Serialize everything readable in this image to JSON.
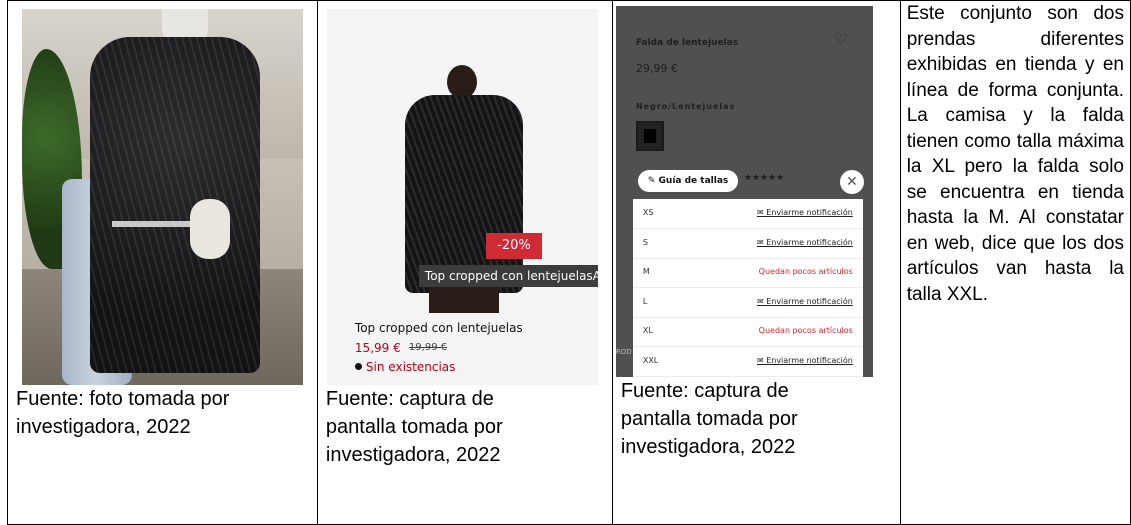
{
  "cells": [
    {
      "caption": "Fuente: foto tomada por investigadora, 2022",
      "caption_lines": [
        "Fuente: foto tomada por",
        "investigadora, 2022"
      ]
    },
    {
      "caption_lines": [
        "Fuente: captura de",
        "pantalla tomada por",
        "investigadora, 2022"
      ],
      "product": {
        "badge": "-20%",
        "tooltip": "Top cropped con lentejuelasAux",
        "name": "Top cropped con lentejuelas",
        "price": "15,99 €",
        "old_price": "19,99 €",
        "stock": "Sin existencias"
      }
    },
    {
      "caption_lines": [
        "Fuente: captura de",
        "pantalla tomada por",
        "investigadora, 2022"
      ],
      "product": {
        "name": "Falda de lentejuelas",
        "heart": "♡",
        "price": "29,99 €",
        "color": "Negro/Lentejuelas",
        "guide": "Guía de tallas",
        "stars": "★★★★★",
        "close": "✕",
        "edge": "ROD",
        "sizes": [
          {
            "size": "XS",
            "status": "Enviarme notificación",
            "alert": false
          },
          {
            "size": "S",
            "status": "Enviarme notificación",
            "alert": false
          },
          {
            "size": "M",
            "status": "Quedan pocos artículos",
            "alert": true
          },
          {
            "size": "L",
            "status": "Enviarme notificación",
            "alert": false
          },
          {
            "size": "XL",
            "status": "Quedan pocos artículos",
            "alert": true
          },
          {
            "size": "XXL",
            "status": "Enviarme notificación",
            "alert": false
          }
        ]
      }
    }
  ],
  "note": "Este conjunto son dos prendas diferentes exhibidas en tienda y en línea de forma conjunta. La camisa y la falda tienen como talla máxima la XL pero la falda solo se encuentra en tienda hasta la M. Al constatar en web, dice que los dos artículos van hasta la talla XXL."
}
